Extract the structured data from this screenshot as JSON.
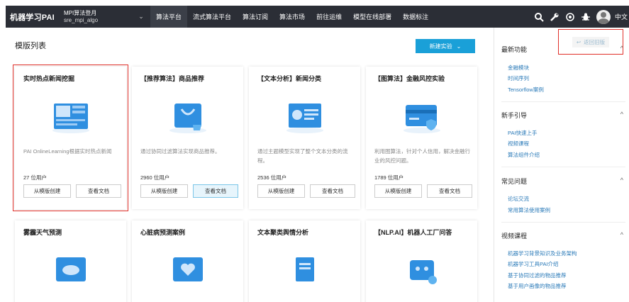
{
  "topbar": {
    "brand": "机器学习PAI",
    "account_line1": "MPI算法登月",
    "account_line2": "sre_mpi_algo",
    "nav": [
      "算法平台",
      "流式算法平台",
      "算法订阅",
      "算法市场",
      "前往运维",
      "模型在线部署",
      "数据标注"
    ],
    "active_nav": "算法平台",
    "lang": "中文"
  },
  "main": {
    "title": "模版列表",
    "new_experiment": "新建实验"
  },
  "cards": [
    {
      "title": "实时热点新闻挖掘",
      "desc": "PAI OnlineLearning根据实时热点新闻",
      "users": "27 位用户",
      "create": "从模版创建",
      "doc": "查看文档"
    },
    {
      "title": "【推荐算法】商品推荐",
      "desc": "通过协同过滤算法实现商品推荐。",
      "users": "2960 位用户",
      "create": "从模版创建",
      "doc": "查看文档"
    },
    {
      "title": "【文本分析】新闻分类",
      "desc": "通过主题模型实现了整个文本分类的流程。",
      "users": "2536 位用户",
      "create": "从模版创建",
      "doc": "查看文档"
    },
    {
      "title": "【图算法】金融风控实验",
      "desc": "利用图算法，针对个人信用，解决金融行业的风控问题。",
      "users": "1789 位用户",
      "create": "从模版创建",
      "doc": "查看文档"
    },
    {
      "title": "雾霾天气预测"
    },
    {
      "title": "心脏病预测案例"
    },
    {
      "title": "文本聚类舆情分析"
    },
    {
      "title": "【NLP.AI】机器人工厂问答"
    }
  ],
  "right": {
    "back_old": "返回旧版",
    "sections": [
      {
        "title": "最新功能",
        "links": [
          "金融模块",
          "时间序列",
          "Tensorflow案例"
        ]
      },
      {
        "title": "新手引导",
        "links": [
          "PAI快速上手",
          "视频课程",
          "算法组件介绍"
        ]
      },
      {
        "title": "常见问题",
        "links": [
          "论坛交流",
          "常用算法使用案例"
        ]
      },
      {
        "title": "视频课程",
        "links": [
          "机器学习背景知识及业务架构",
          "机器学习工具PAI介绍",
          "基于协同过滤的物品推荐",
          "基于用户画像的物品推荐"
        ]
      }
    ]
  },
  "colors": {
    "topbar": "#2b2e36",
    "accent": "#1aa0d8",
    "highlight": "#e0302a",
    "link": "#2a7ab8"
  }
}
